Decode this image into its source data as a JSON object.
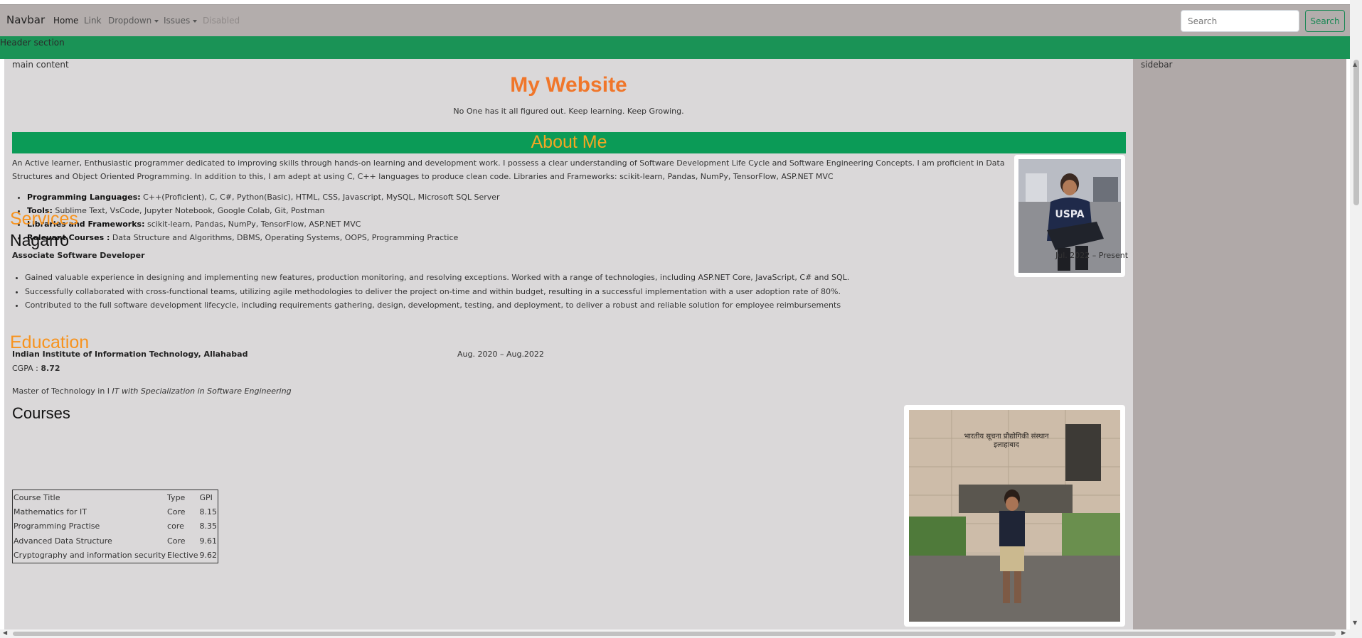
{
  "navbar": {
    "brand": "Navbar",
    "links": [
      {
        "label": "Home"
      },
      {
        "label": "Link"
      },
      {
        "label": "Dropdown"
      },
      {
        "label": "Issues"
      },
      {
        "label": "Disabled"
      }
    ],
    "search_placeholder": "Search",
    "search_button": "Search"
  },
  "header": {
    "label": "Header section"
  },
  "main": {
    "label": "main content",
    "site_title": "My Website",
    "tagline": "No One has it all figured out. Keep learning. Keep Growing.",
    "about": {
      "title": "About Me",
      "paragraph": "An Active learner, Enthusiastic programmer dedicated to improving skills through hands-on learning and development work. I possess a clear understanding of Software Development Life Cycle and Software Engineering Concepts. I am proficient in Data Structures and Object Oriented Programming. In addition to this, I am adept at using C, C++ languages to produce clean code. Libraries and Frameworks: scikit-learn, Pandas, NumPy, TensorFlow, ASP.NET MVC",
      "skills": [
        {
          "label": "Programming Languages:",
          "value": " C++(Proficient), C, C#, Python(Basic), HTML, CSS, Javascript, MySQL, Microsoft SQL Server"
        },
        {
          "label": "Tools:",
          "value": " Sublime Text, VsCode, Jupyter Notebook, Google Colab, Git, Postman"
        },
        {
          "label": "Libraries and Frameworks:",
          "value": " scikit-learn, Pandas, NumPy, TensorFlow, ASP.NET MVC"
        },
        {
          "label": "Relevant Courses :",
          "value": " Data Structure and Algorithms, DBMS, Operating Systems, OOPS, Programming Practice"
        }
      ]
    },
    "services": {
      "title": "Services",
      "company": "Nagarro",
      "role": "Associate Software Developer",
      "date": "Jul. 2022 – Present",
      "duties": [
        "Gained valuable experience in designing and implementing new features, production monitoring, and resolving exceptions. Worked with a range of technologies, including ASP.NET Core, JavaScript, C# and SQL.",
        "Successfully collaborated with cross-functional teams, utilizing agile methodologies to deliver the project on-time and within budget, resulting in a successful implementation with a user adoption rate of 80%.",
        "Contributed to the full software development lifecycle, including requirements gathering, design, development, testing, and deployment, to deliver a robust and reliable solution for employee reimbursements"
      ]
    },
    "education": {
      "title": "Education",
      "institute": "Indian Institute of Information Technology, Allahabad",
      "date": "Aug. 2020 – Aug.2022",
      "cgpa_label": "CGPA : ",
      "cgpa_value": "8.72",
      "degree_prefix": "Master of Technology in I ",
      "degree_spec": "IT with Specialization in Software Engineering",
      "photo_sign_line1": "भारतीय सूचना प्रौद्योगिकी संस्थान",
      "photo_sign_line2": "इलाहाबाद"
    },
    "courses": {
      "title": "Courses",
      "headers": [
        "Course Title",
        "Type",
        "GPI"
      ],
      "rows": [
        [
          "Mathematics for IT",
          "Core",
          "8.15"
        ],
        [
          "Programming Practise",
          "core",
          "8.35"
        ],
        [
          "Advanced Data Structure",
          "Core",
          "9.61"
        ],
        [
          "Cryptography and information security",
          "Elective",
          "9.62"
        ]
      ]
    }
  },
  "sidebar": {
    "label": "sidebar"
  },
  "colors": {
    "navbar": "#b3adac",
    "header": "#1a9356",
    "title_orange": "#f0762a",
    "section_orange": "#f7931e",
    "main_bg": "#dad8d9",
    "sidebar_bg": "#b0a9a8"
  }
}
